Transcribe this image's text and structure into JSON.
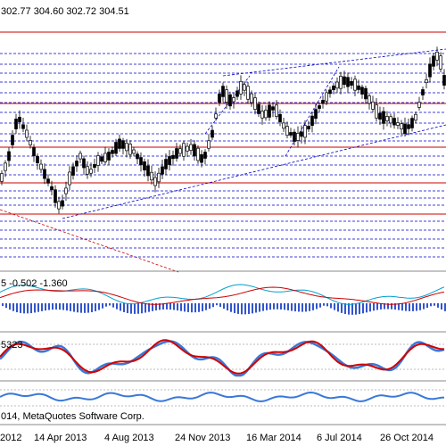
{
  "header": {
    "ohlc_text": "302.77 304.60 302.72 304.51"
  },
  "macd": {
    "label": "5 -0.502 -1.360"
  },
  "stochastic": {
    "label": "5323"
  },
  "bottom": {
    "copyright": "014, MetaQuotes Software Corp."
  },
  "xaxis": {
    "dates": [
      "2012",
      "14 Apr 2013",
      "4 Aug 2013",
      "24 Nov 2013",
      "16 Mar 2014",
      "6 Jul 2014",
      "26 Oct 2014"
    ]
  },
  "colors": {
    "background": "#ffffff",
    "candles": "#000000",
    "dashed_levels": "#0000cc",
    "red_levels": "#cc0000",
    "macd_signal": "#d00000",
    "macd_line": "#00a0d0",
    "macd_histogram": "#3355cc",
    "stoch_main": "#d00000",
    "stoch_signal": "#3a78d8",
    "osc_line": "#3a78d8"
  }
}
